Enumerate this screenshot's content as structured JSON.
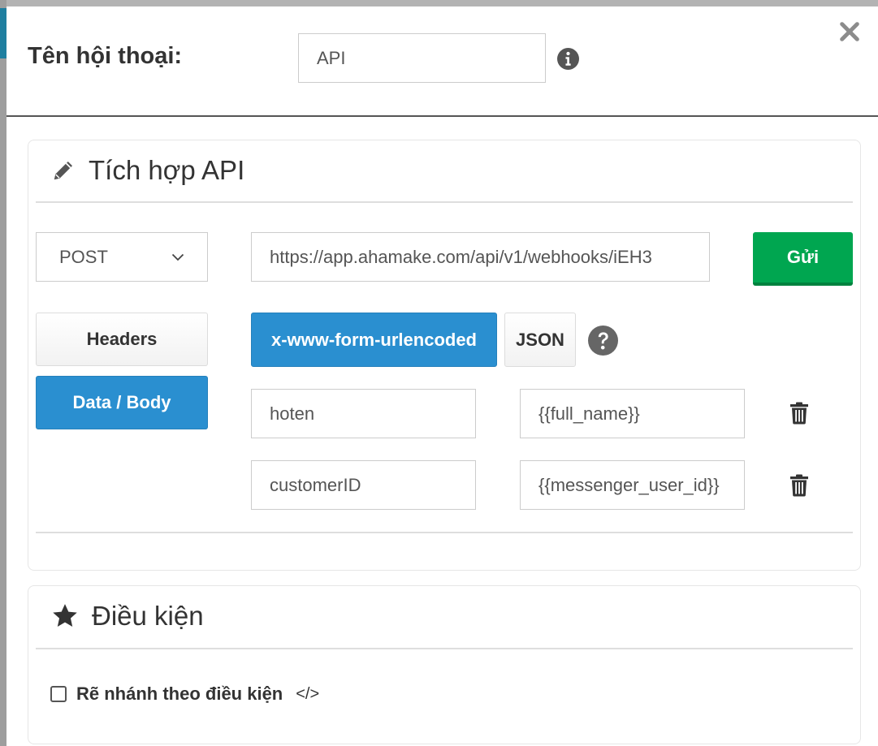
{
  "header": {
    "dialog_name_label": "Tên hội thoại:",
    "dialog_name_value": "API"
  },
  "api_panel": {
    "title": "Tích hợp API",
    "method": "POST",
    "url": "https://app.ahamake.com/api/v1/webhooks/iEH3",
    "send_label": "Gửi",
    "tabs": [
      {
        "label": "Headers",
        "active": false
      },
      {
        "label": "Data / Body",
        "active": true
      }
    ],
    "body_types": [
      {
        "label": "x-www-form-urlencoded",
        "active": true
      },
      {
        "label": "JSON",
        "active": false
      }
    ],
    "params": [
      {
        "key": "hoten",
        "value": "{{full_name}}"
      },
      {
        "key": "customerID",
        "value": "{{messenger_user_id}}"
      }
    ]
  },
  "condition_panel": {
    "title": "Điều kiện",
    "branch_label": "Rẽ nhánh theo điều kiện",
    "branch_checked": false,
    "code_symbol": "</>"
  },
  "colors": {
    "primary_blue": "#2a8fd0",
    "send_green": "#00a650"
  },
  "icons": {
    "info": "info-circle-icon",
    "close": "close-icon",
    "edit": "pencil-icon",
    "help": "question-circle-icon",
    "delete": "trash-icon",
    "condition": "star-icon",
    "dropdown": "chevron-down-icon"
  }
}
